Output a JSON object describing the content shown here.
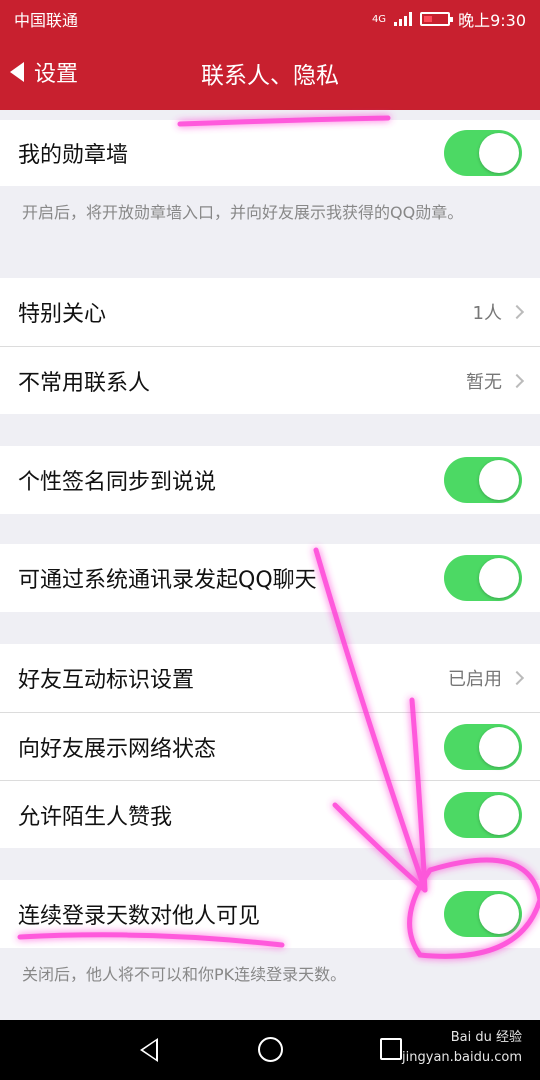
{
  "status": {
    "carrier": "中国联通",
    "network": "4G",
    "time": "晚上9:30"
  },
  "header": {
    "back_label": "设置",
    "title": "联系人、隐私"
  },
  "items": [
    {
      "label": "我的勋章墙",
      "type": "toggle",
      "on": true
    },
    {
      "label": "特别关心",
      "type": "link",
      "value": "1人"
    },
    {
      "label": "不常用联系人",
      "type": "link",
      "value": "暂无"
    },
    {
      "label": "个性签名同步到说说",
      "type": "toggle",
      "on": true
    },
    {
      "label": "可通过系统通讯录发起QQ聊天",
      "type": "toggle",
      "on": true
    },
    {
      "label": "好友互动标识设置",
      "type": "link",
      "value": "已启用"
    },
    {
      "label": "向好友展示网络状态",
      "type": "toggle",
      "on": true
    },
    {
      "label": "允许陌生人赞我",
      "type": "toggle",
      "on": true
    },
    {
      "label": "连续登录天数对他人可见",
      "type": "toggle",
      "on": true
    }
  ],
  "descriptions": {
    "medal": "开启后，将开放勋章墙入口，并向好友展示我获得的QQ勋章。",
    "login_days": "关闭后，他人将不可以和你PK连续登录天数。"
  },
  "watermark": {
    "brand": "Bai du 经验",
    "url": "jingyan.baidu.com"
  },
  "colors": {
    "header_bg": "#c8202f",
    "toggle_on": "#4cd964",
    "background": "#efeff4",
    "annotation": "#ff3cd6"
  }
}
